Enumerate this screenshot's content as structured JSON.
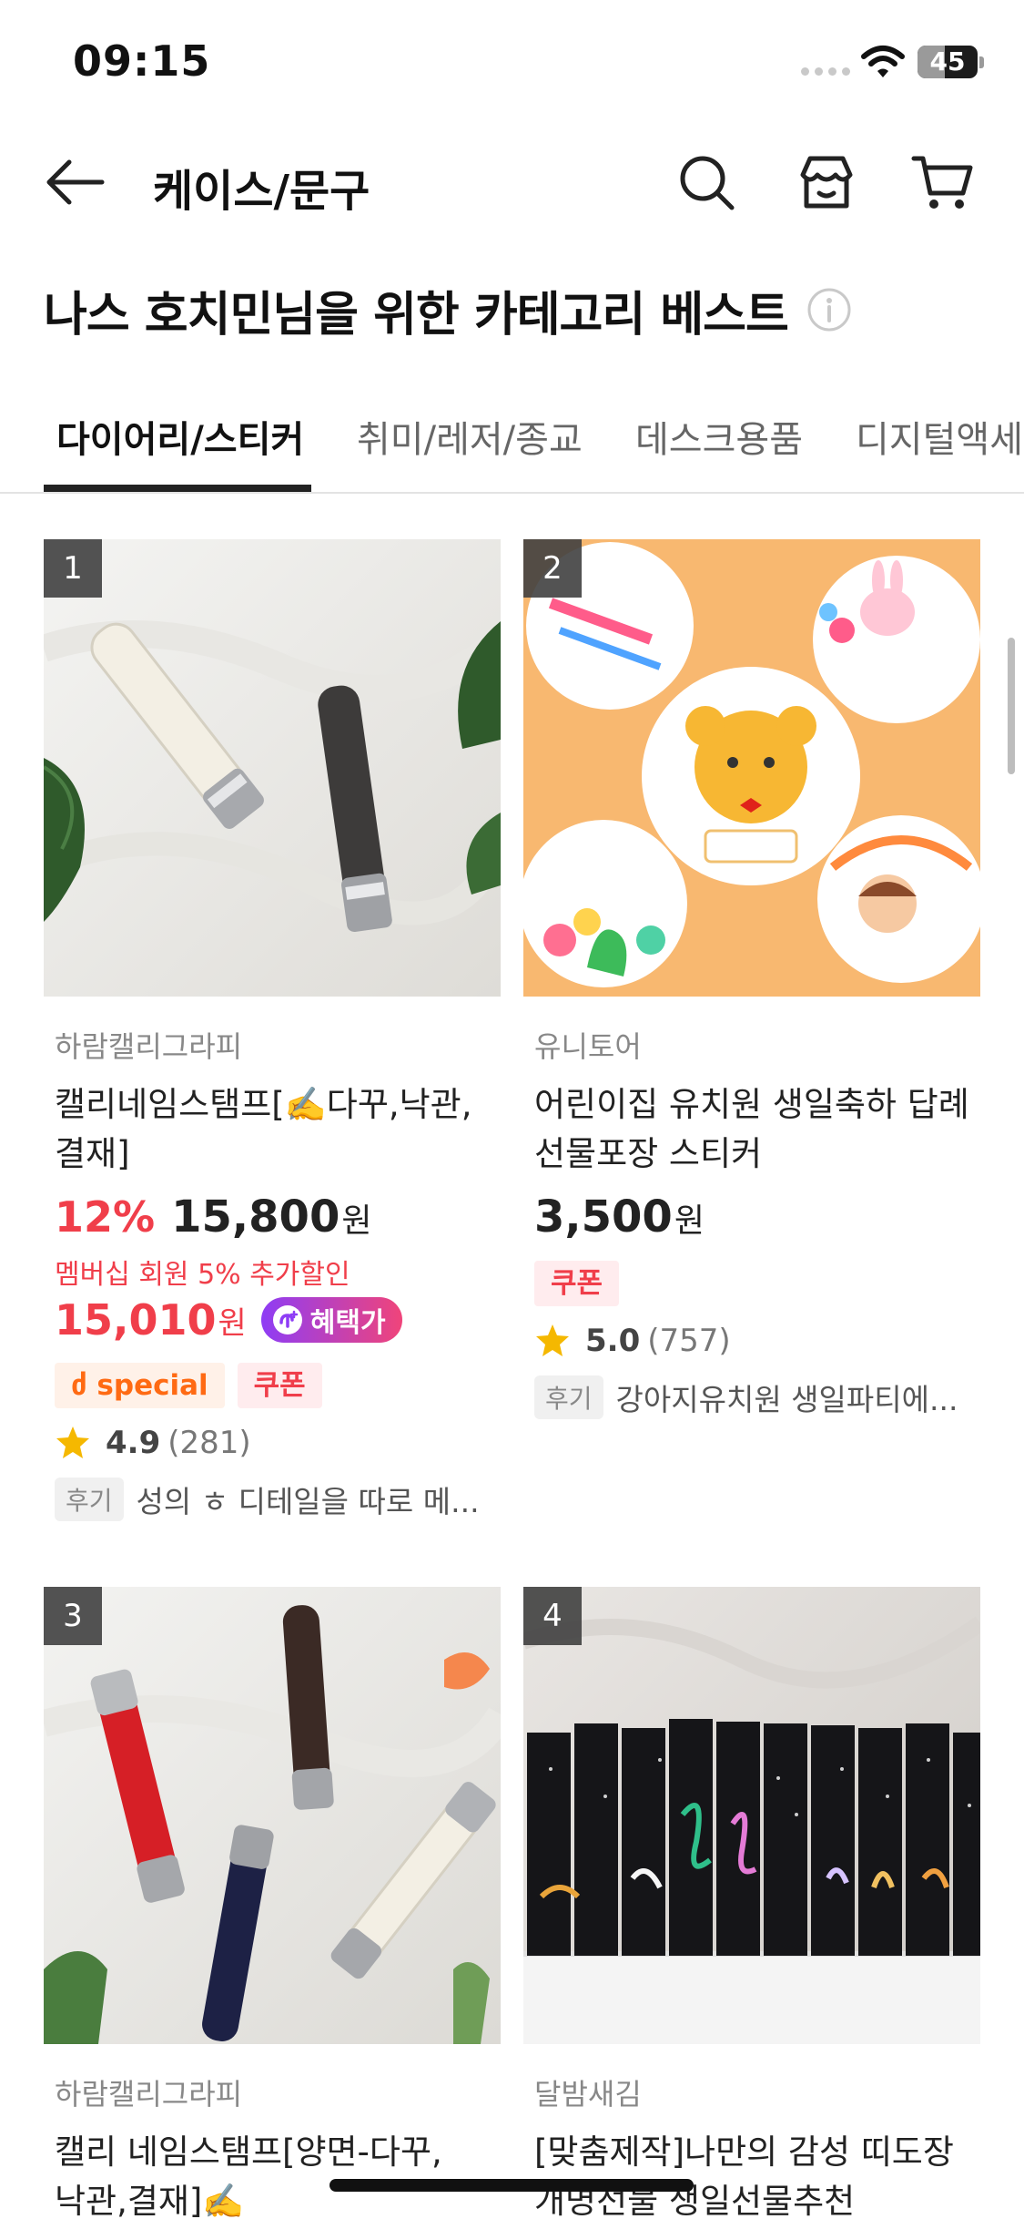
{
  "status_bar": {
    "time": "09:15",
    "battery": "45",
    "battery_level": 0.45
  },
  "header": {
    "title": "케이스/문구",
    "icons": [
      "back-arrow-icon",
      "search-icon",
      "store-icon",
      "cart-icon"
    ]
  },
  "section": {
    "title": "나스 호치민님을 위한 카테고리 베스트"
  },
  "tabs": [
    {
      "label": "다이어리/스티커",
      "active": true
    },
    {
      "label": "취미/레저/종교",
      "active": false
    },
    {
      "label": "데스크용품",
      "active": false
    },
    {
      "label": "디지털액세서리",
      "active": false
    }
  ],
  "products": [
    {
      "rank": "1",
      "store": "하람캘리그라피",
      "name": "캘리네임스탬프[✍️다꾸,낙관,결재]",
      "discount": "12%",
      "price": "15,800",
      "currency": "원",
      "member_note": "멤버십 회원 5% 추가할인",
      "member_price": "15,010",
      "benefit_label": "혜택가",
      "badges": [
        "special",
        "쿠폰"
      ],
      "rating": "4.9",
      "review_count": "(281)",
      "review_label": "후기",
      "review_text": "성의 ㅎ 디테일을 따로 메..."
    },
    {
      "rank": "2",
      "store": "유니토어",
      "name": "어린이집 유치원 생일축하 답례 선물포장 스티커",
      "price": "3,500",
      "currency": "원",
      "badges": [
        "쿠폰"
      ],
      "rating": "5.0",
      "review_count": "(757)",
      "review_label": "후기",
      "review_text": "강아지유치원 생일파티에..."
    },
    {
      "rank": "3",
      "store": "하람캘리그라피",
      "name": "캘리 네임스탬프[양면-다꾸,낙관,결재]✍️"
    },
    {
      "rank": "4",
      "store": "달밤새김",
      "name": "[맞춤제작]나만의 감성 띠도장 개명선물 생일선물추천"
    }
  ],
  "colors": {
    "accent_red": "#f03e4a",
    "special_orange": "#ff6a13",
    "benefit_gradient_start": "#8e3df5",
    "benefit_gradient_end": "#f0447a",
    "star": "#f5b800"
  }
}
